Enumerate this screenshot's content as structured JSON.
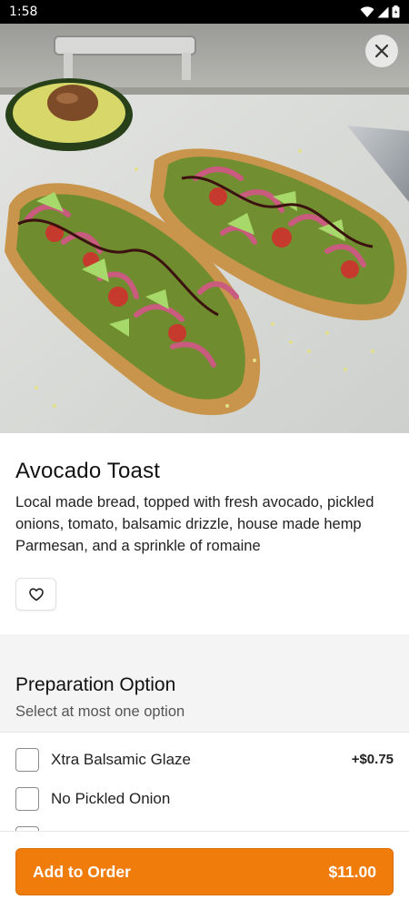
{
  "status_bar": {
    "time": "1:58"
  },
  "item": {
    "title": "Avocado Toast",
    "description": "Local made bread, topped with fresh avocado, pickled onions, tomato, balsamic drizzle, house made hemp Parmesan, and a sprinkle of romaine"
  },
  "preparation": {
    "title": "Preparation Option",
    "subtitle": "Select at most one option",
    "options": [
      {
        "label": "Xtra Balsamic Glaze",
        "price": "+$0.75"
      },
      {
        "label": "No Pickled Onion",
        "price": ""
      }
    ]
  },
  "order": {
    "button_label": "Add to Order",
    "price": "$11.00"
  },
  "colors": {
    "accent": "#f07c0b",
    "section_bg": "#f4f4f5"
  }
}
